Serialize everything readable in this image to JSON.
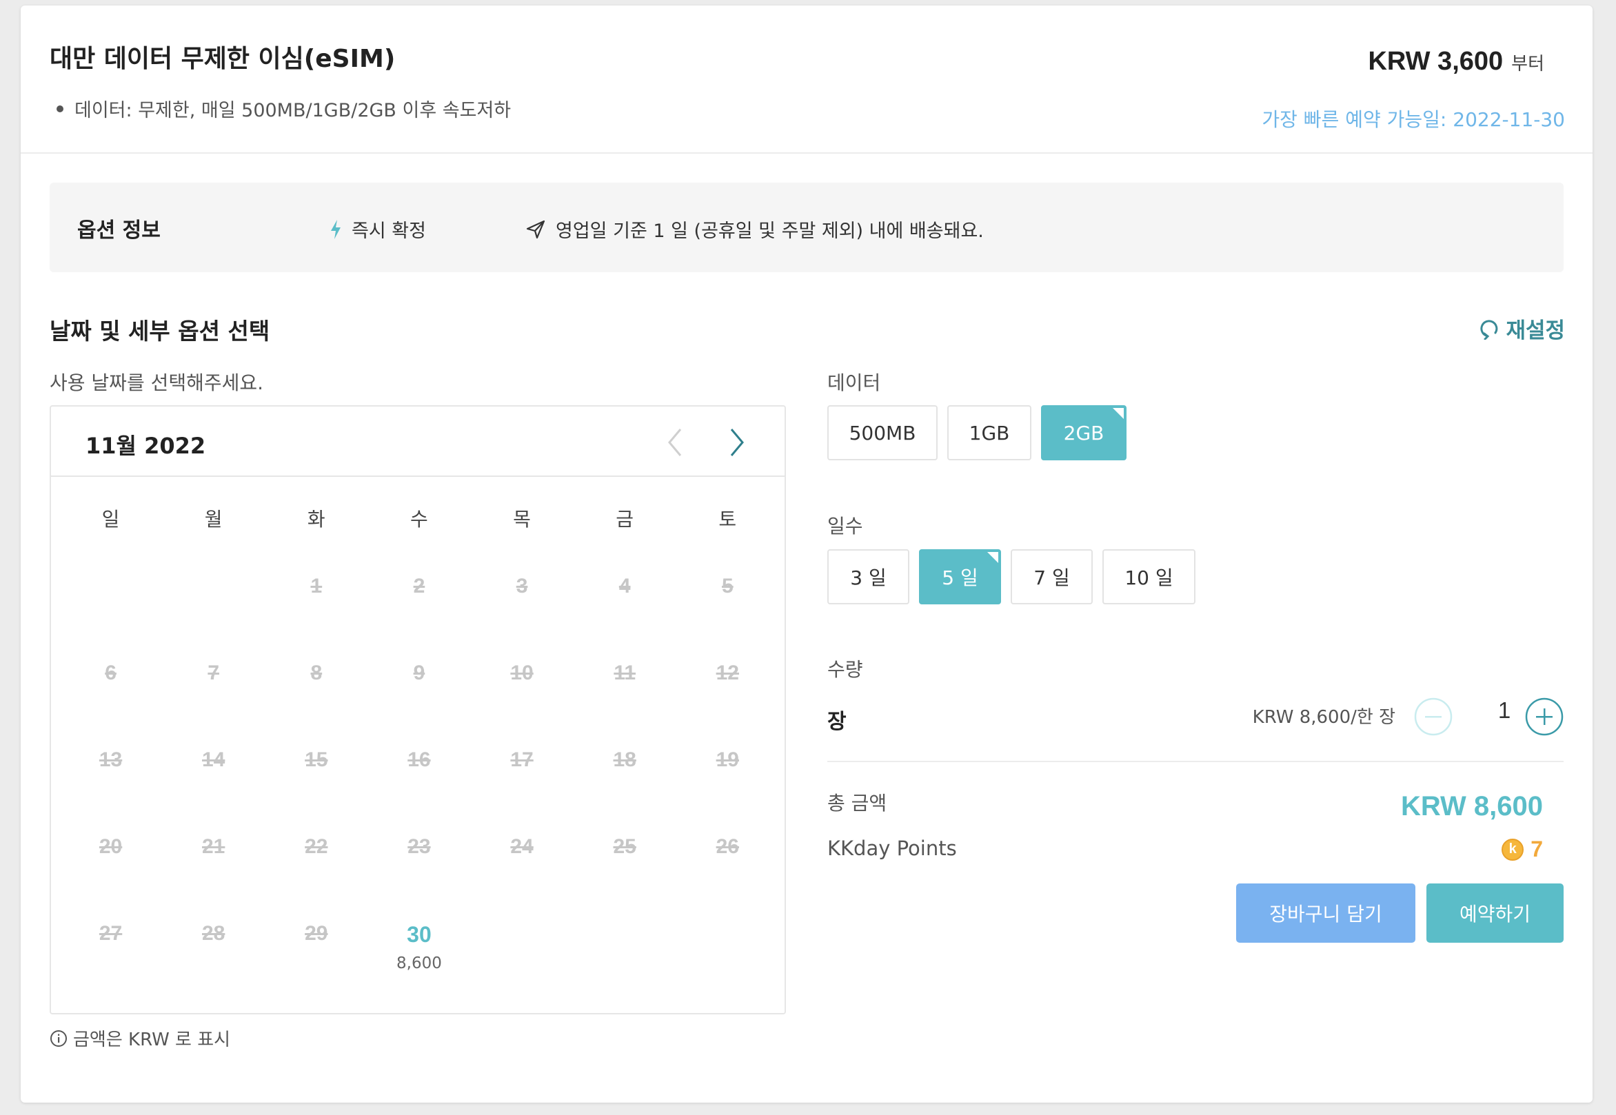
{
  "product": {
    "title": "대만 데이터 무제한 이심(eSIM)",
    "bullet": "데이터: 무제한, 매일 500MB/1GB/2GB 이후 속도저하",
    "price": "KRW 3,600",
    "price_suffix": "부터",
    "earliest": "가장 빠른 예약 가능일: 2022-11-30"
  },
  "option_info": {
    "label": "옵션 정보",
    "instant": "즉시 확정",
    "delivery": "영업일 기준 1 일 (공휴일 및 주말 제외) 내에 배송돼요."
  },
  "section": {
    "title": "날짜 및 세부 옵션 선택",
    "reset": "재설정",
    "hint": "사용 날짜를 선택해주세요."
  },
  "calendar": {
    "month": "11월 2022",
    "weekdays": [
      "일",
      "월",
      "화",
      "수",
      "목",
      "금",
      "토"
    ],
    "weeks": [
      [
        null,
        null,
        "1",
        "2",
        "3",
        "4",
        "5"
      ],
      [
        "6",
        "7",
        "8",
        "9",
        "10",
        "11",
        "12"
      ],
      [
        "13",
        "14",
        "15",
        "16",
        "17",
        "18",
        "19"
      ],
      [
        "20",
        "21",
        "22",
        "23",
        "24",
        "25",
        "26"
      ],
      [
        "27",
        "28",
        "29",
        "30",
        null,
        null,
        null
      ]
    ],
    "available": {
      "30": "8,600"
    },
    "note": "금액은 KRW 로 표시"
  },
  "data_option": {
    "label": "데이터",
    "options": [
      "500MB",
      "1GB",
      "2GB"
    ],
    "selected": "2GB"
  },
  "days_option": {
    "label": "일수",
    "options": [
      "3 일",
      "5 일",
      "7 일",
      "10 일"
    ],
    "selected": "5 일"
  },
  "quantity": {
    "label": "수량",
    "unit_name": "장",
    "unit_price": "KRW 8,600/한 장",
    "value": "1"
  },
  "total": {
    "label": "총 금액",
    "amount": "KRW 8,600",
    "points_label": "KKday Points",
    "coin": "k",
    "points": "7"
  },
  "buttons": {
    "cart": "장바구니 담기",
    "book": "예약하기"
  },
  "colors": {
    "accent": "#5bbdc8",
    "cart": "#7ab2f0",
    "link": "#6fb6e8",
    "points": "#f2a93b"
  }
}
